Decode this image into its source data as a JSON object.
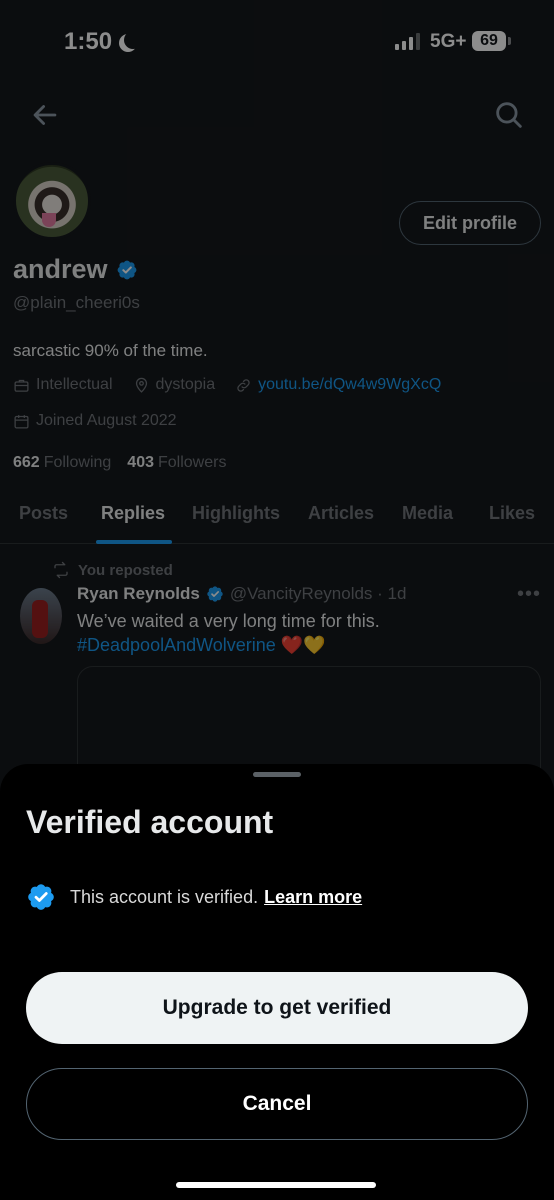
{
  "status_bar": {
    "time": "1:50",
    "network": "5G+",
    "battery": "69"
  },
  "profile": {
    "name": "andrew",
    "handle": "@plain_cheeri0s",
    "bio": "sarcastic 90% of the time.",
    "category": "Intellectual",
    "location": "dystopia",
    "website": "youtu.be/dQw4w9WgXcQ",
    "joined": "Joined August 2022",
    "following_count": "662",
    "following_label": "Following",
    "followers_count": "403",
    "followers_label": "Followers",
    "edit_button": "Edit profile"
  },
  "tabs": [
    "Posts",
    "Replies",
    "Highlights",
    "Articles",
    "Media",
    "Likes"
  ],
  "active_tab": "Replies",
  "post": {
    "repost_label": "You reposted",
    "author": "Ryan Reynolds",
    "author_handle": "@VancityReynolds · 1d",
    "text": "We’ve waited a very long time for this.",
    "hashtag": "#DeadpoolAndWolverine",
    "emojis": "❤️💛"
  },
  "sheet": {
    "title": "Verified account",
    "message": "This account is verified.",
    "learn_more": "Learn more",
    "upgrade_button": "Upgrade to get verified",
    "cancel_button": "Cancel"
  },
  "colors": {
    "accent": "#1d9bf0",
    "background": "#15181c",
    "sheet": "#000000"
  }
}
